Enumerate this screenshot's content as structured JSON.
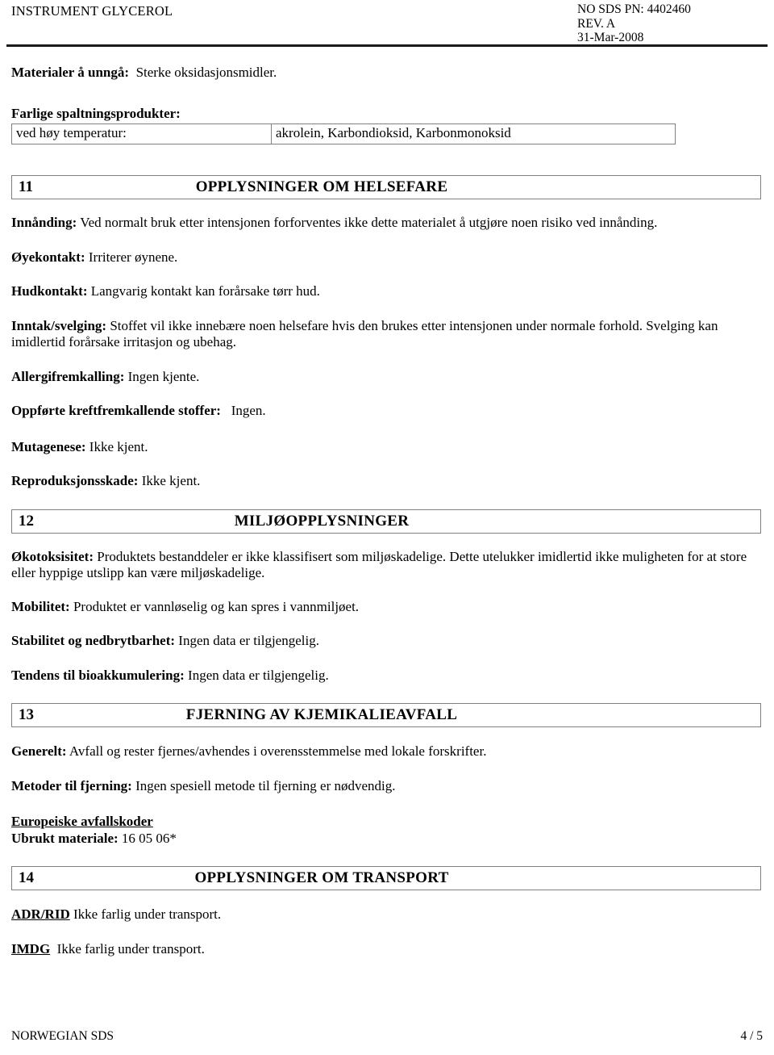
{
  "header": {
    "product": "INSTRUMENT GLYCEROL",
    "sds_pn": "NO SDS PN: 4402460",
    "revision": "REV. A",
    "date": "31-Mar-2008"
  },
  "top": {
    "materials_label": "Materialer å unngå:",
    "materials_value": "Sterke oksidasjonsmidler.",
    "decomposition_heading": "Farlige spaltningsprodukter:",
    "table": {
      "rows": [
        {
          "condition": "ved høy temperatur:",
          "products": "akrolein, Karbondioksid, Karbonmonoksid"
        }
      ]
    }
  },
  "sections": [
    {
      "number": "11",
      "title": "OPPLYSNINGER OM HELSEFARE",
      "entries": [
        {
          "label": "Innånding:",
          "text": "Ved normalt bruk etter intensjonen forforventes ikke dette materialet å utgjøre noen risiko ved innånding."
        },
        {
          "label": "Øyekontakt:",
          "text": "Irriterer øynene."
        },
        {
          "label": "Hudkontakt:",
          "text": "Langvarig kontakt kan forårsake tørr hud."
        },
        {
          "label": "Inntak/svelging:",
          "text": "Stoffet vil ikke innebære noen helsefare hvis den brukes etter intensjonen under normale forhold. Svelging kan imidlertid forårsake irritasjon og ubehag."
        },
        {
          "label": "Allergifremkalling:",
          "text": "Ingen kjente."
        },
        {
          "label": "Oppførte kreftfremkallende stoffer:",
          "text": "Ingen."
        },
        {
          "label": "Mutagenese:",
          "text": "Ikke kjent."
        },
        {
          "label": "Reproduksjonsskade:",
          "text": "Ikke kjent."
        }
      ]
    },
    {
      "number": "12",
      "title": "MILJØOPPLYSNINGER",
      "entries": [
        {
          "label": "Økotoksisitet:",
          "text": "Produktets bestanddeler er ikke klassifisert som miljøskadelige. Dette utelukker imidlertid ikke muligheten for at store eller hyppige utslipp kan være miljøskadelige."
        },
        {
          "label": "Mobilitet:",
          "text": "Produktet er vannløselig og kan spres i vannmiljøet."
        },
        {
          "label": "Stabilitet og nedbrytbarhet:",
          "text": "Ingen data er tilgjengelig."
        },
        {
          "label": "Tendens til bioakkumulering:",
          "text": "Ingen data er tilgjengelig."
        }
      ]
    },
    {
      "number": "13",
      "title": "FJERNING AV KJEMIKALIEAVFALL",
      "entries": [
        {
          "label": "Generelt:",
          "text": "Avfall og rester fjernes/avhendes i overensstemmelse med lokale forskrifter."
        },
        {
          "label": "Metoder til fjerning:",
          "text": "Ingen spesiell metode til fjerning er nødvendig."
        }
      ],
      "waste_codes_heading": "Europeiske avfallskoder",
      "waste_code_label": "Ubrukt materiale:",
      "waste_code_value": "16 05 06*"
    },
    {
      "number": "14",
      "title": "OPPLYSNINGER OM TRANSPORT",
      "entries": [
        {
          "label": "ADR/RID",
          "text": "Ikke farlig under transport."
        },
        {
          "label": "IMDG",
          "text": "Ikke farlig under transport."
        }
      ]
    }
  ],
  "footer": {
    "left": "NORWEGIAN SDS",
    "right": "4 /  5"
  }
}
